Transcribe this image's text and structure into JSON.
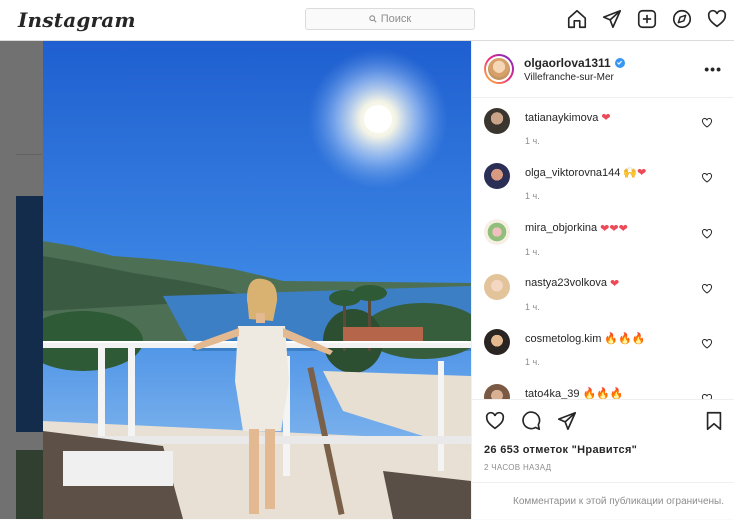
{
  "app": {
    "logo_text": "Instagram",
    "search_placeholder": "Поиск"
  },
  "post": {
    "username": "olgaorlova1311",
    "location": "Villefranche-sur-Mer",
    "likes_text": "26 653 отметок \"Нравится\"",
    "posted_text": "2 ЧАСОВ НАЗАД",
    "comments_restricted_text": "Комментарии к этой публикации ограничены."
  },
  "comments": [
    {
      "user": "tatianaykimova",
      "emoji": "❤",
      "time": "1 ч."
    },
    {
      "user": "olga_viktorovna144",
      "emoji": "🙌❤",
      "time": "1 ч."
    },
    {
      "user": "mira_objorkina",
      "emoji": "❤❤❤",
      "time": "1 ч."
    },
    {
      "user": "nastya23volkova",
      "emoji": "❤",
      "time": "1 ч."
    },
    {
      "user": "cosmetolog.kim",
      "emoji": "🔥🔥🔥",
      "time": "1 ч."
    },
    {
      "user": "tato4ka_39",
      "emoji": "🔥🔥🔥",
      "time": ""
    }
  ],
  "icons": {
    "nav": [
      "home-icon",
      "direct-icon",
      "new-post-icon",
      "explore-icon",
      "activity-heart-icon"
    ],
    "actions": [
      "like-icon",
      "comment-icon",
      "share-icon",
      "save-icon"
    ]
  },
  "colors": {
    "accent": "#3897f0",
    "heart": "#ed4956",
    "text": "#262626",
    "muted": "#8e8e8e"
  }
}
